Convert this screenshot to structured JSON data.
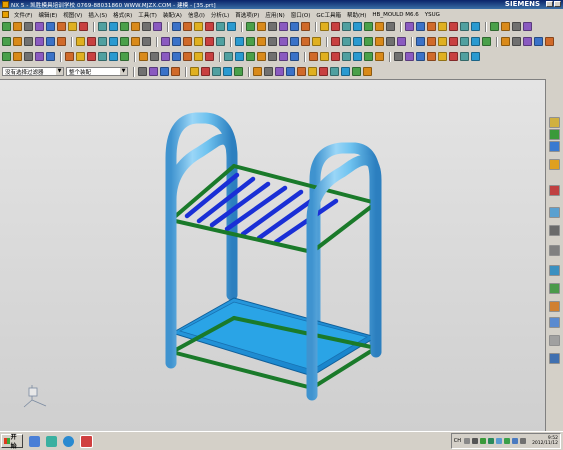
{
  "window": {
    "title": "NX 5 - 凯胜模具培训学校 0769-88031860 WWW.MJZX.COM - 建模 - [35.prt]",
    "brand": "SIEMENS"
  },
  "menu": {
    "items": [
      "文件(F)",
      "编辑(E)",
      "视图(V)",
      "插入(S)",
      "格式(R)",
      "工具(T)",
      "装配(A)",
      "信息(I)",
      "分析(L)",
      "首选项(P)",
      "应用(N)",
      "窗口(O)",
      "GC工具箱",
      "帮助(H)",
      "HB_MOULD M6.6",
      "YSUG"
    ]
  },
  "selection_bar": {
    "filter_value": "没有选择过滤器",
    "assembly_value": "整个装配"
  },
  "taskbar": {
    "start_label": "开始",
    "tray_lang": "CH",
    "clock_time": "9:52",
    "clock_date": "2012/11/12"
  },
  "colors": {
    "tube": "#5fb8ec",
    "frame_bar": "#1a7a2a",
    "slats": "#1a2fd6",
    "tray": "#1e8fd8",
    "titlebar": "#0a246a"
  }
}
